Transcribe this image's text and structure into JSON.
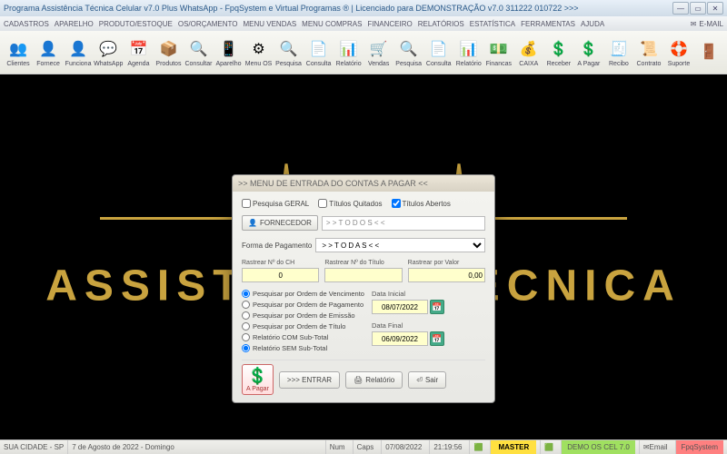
{
  "titlebar": {
    "title": "Programa Assistência Técnica Celular v7.0 Plus WhatsApp - FpqSystem e Virtual Programas ® | Licenciado para  DEMONSTRAÇÃO v7.0 311222 010722 >>>"
  },
  "menubar": {
    "items": [
      "CADASTROS",
      "APARELHO",
      "PRODUTO/ESTOQUE",
      "OS/ORÇAMENTO",
      "MENU VENDAS",
      "MENU COMPRAS",
      "FINANCEIRO",
      "RELATÓRIOS",
      "ESTATÍSTICA",
      "FERRAMENTAS",
      "AJUDA"
    ],
    "email": "E-MAIL"
  },
  "toolbar": {
    "items": [
      {
        "label": "Clientes",
        "icon": "👥"
      },
      {
        "label": "Fornece",
        "icon": "👤"
      },
      {
        "label": "Funciona",
        "icon": "👤"
      },
      {
        "label": "WhatsApp",
        "icon": "💬"
      },
      {
        "label": "Agenda",
        "icon": "📅"
      },
      {
        "label": "Produtos",
        "icon": "📦"
      },
      {
        "label": "Consultar",
        "icon": "🔍"
      },
      {
        "label": "Aparelho",
        "icon": "📱"
      },
      {
        "label": "Menu OS",
        "icon": "⚙"
      },
      {
        "label": "Pesquisa",
        "icon": "🔍"
      },
      {
        "label": "Consulta",
        "icon": "📄"
      },
      {
        "label": "Relatório",
        "icon": "📊"
      },
      {
        "label": "Vendas",
        "icon": "🛒"
      },
      {
        "label": "Pesquisa",
        "icon": "🔍"
      },
      {
        "label": "Consulta",
        "icon": "📄"
      },
      {
        "label": "Relatório",
        "icon": "📊"
      },
      {
        "label": "Financas",
        "icon": "💵"
      },
      {
        "label": "CAIXA",
        "icon": "💰"
      },
      {
        "label": "Receber",
        "icon": "💲"
      },
      {
        "label": "A Pagar",
        "icon": "💲"
      },
      {
        "label": "Recibo",
        "icon": "🧾"
      },
      {
        "label": "Contrato",
        "icon": "📜"
      },
      {
        "label": "Suporte",
        "icon": "🛟"
      },
      {
        "label": "",
        "icon": "🚪"
      }
    ]
  },
  "background": {
    "text": "ASSISTÊNCIA TÉCNICA"
  },
  "dialog": {
    "title": ">>  MENU DE ENTRADA DO CONTAS A PAGAR  <<",
    "checks": {
      "geral": "Pesquisa GERAL",
      "quitados": "Títulos Quitados",
      "abertos": "Títulos Abertos"
    },
    "fornecedor": {
      "button": "FORNECEDOR",
      "value": "> > T O D O S < <"
    },
    "forma": {
      "label": "Forma de Pagamento",
      "value": "> > T O D A S < <"
    },
    "trace": {
      "ch": {
        "label": "Rastrear Nº do CH",
        "value": "0"
      },
      "titulo": {
        "label": "Rastrear Nº do Título",
        "value": ""
      },
      "valor": {
        "label": "Rastrear por Valor",
        "value": "0,00"
      }
    },
    "radios": [
      "Pesquisar por Ordem de Vencimento",
      "Pesquisar por Ordem de Pagamento",
      "Pesquisar por Ordem de Emissão",
      "Pesquisar por Ordem de Título",
      "Relatório COM Sub-Total",
      "Relatório SEM Sub-Total"
    ],
    "dates": {
      "inicial": {
        "label": "Data Inicial",
        "value": "08/07/2022"
      },
      "final": {
        "label": "Data Final",
        "value": "06/09/2022"
      }
    },
    "buttons": {
      "apagar": "A Pagar",
      "entrar": ">>> ENTRAR",
      "relatorio": "Relatório",
      "sair": "Sair"
    }
  },
  "statusbar": {
    "city": "SUA CIDADE - SP",
    "date_long": "7 de Agosto de 2022 - Domingo",
    "num": "Num",
    "caps": "Caps",
    "date": "07/08/2022",
    "time": "21:19:56",
    "master": "MASTER",
    "demo": "DEMO OS CEL 7.0",
    "email": "Email",
    "fpq": "FpqSystem"
  }
}
